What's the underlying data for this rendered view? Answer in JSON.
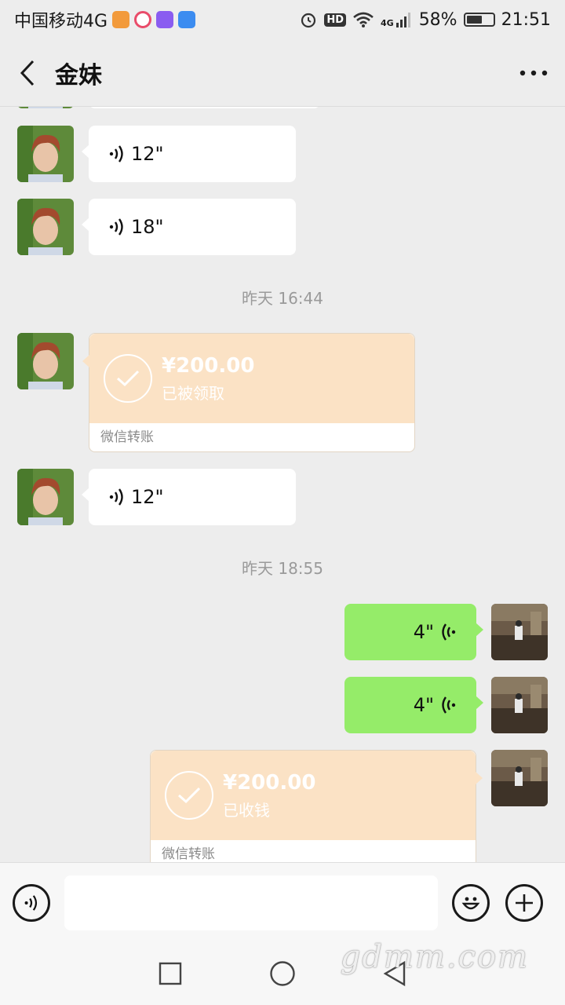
{
  "status_bar": {
    "carrier": "中国移动4G",
    "badge": "HD",
    "network": "4G",
    "battery": "58%",
    "battery_level": 0.58,
    "time": "21:51",
    "icons": [
      "alarm-icon",
      "wifi-icon",
      "signal-icon",
      "battery-icon"
    ]
  },
  "header": {
    "title": "金妹",
    "back_icon": "chevron-left-icon",
    "more_icon": "more-dots-icon"
  },
  "messages": [
    {
      "type": "voice",
      "side": "left",
      "duration": "12\""
    },
    {
      "type": "voice",
      "side": "left",
      "duration": "18\""
    },
    {
      "type": "timestamp",
      "text": "昨天 16:44"
    },
    {
      "type": "transfer",
      "side": "left",
      "amount": "¥200.00",
      "status": "已被领取",
      "footer": "微信转账"
    },
    {
      "type": "voice",
      "side": "left",
      "duration": "12\""
    },
    {
      "type": "timestamp",
      "text": "昨天 18:55"
    },
    {
      "type": "voice",
      "side": "right",
      "duration": "4\""
    },
    {
      "type": "voice",
      "side": "right",
      "duration": "4\""
    },
    {
      "type": "transfer",
      "side": "right",
      "amount": "¥200.00",
      "status": "已收钱",
      "footer": "微信转账"
    }
  ],
  "input_bar": {
    "voice_icon": "voice-input-icon",
    "emoji_icon": "emoji-icon",
    "plus_icon": "plus-icon"
  },
  "watermark": "gdmm.com",
  "colors": {
    "background": "#ededed",
    "bubble_white": "#ffffff",
    "bubble_green": "#95ec69",
    "transfer_orange": "#fbe2c5"
  }
}
